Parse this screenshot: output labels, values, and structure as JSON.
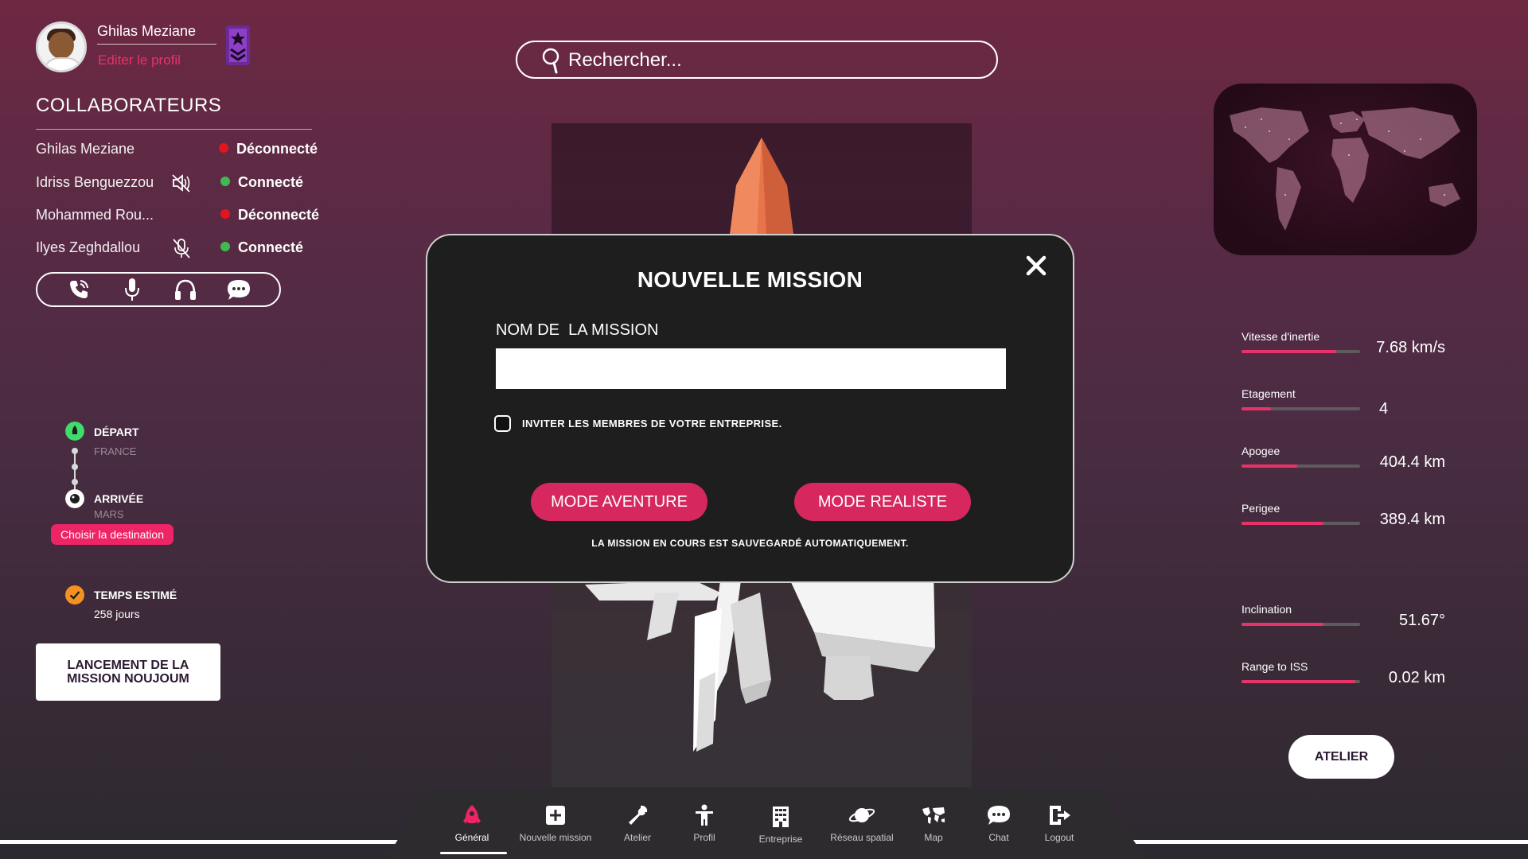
{
  "user": {
    "name": "Ghilas Meziane",
    "edit_label": "Editer le profil"
  },
  "search": {
    "placeholder": "Rechercher..."
  },
  "collaborators": {
    "title": "COLLABORATEURS",
    "items": [
      {
        "name": "Ghilas Meziane",
        "status": "Déconnecté",
        "status_color": "#e4141c",
        "icon": ""
      },
      {
        "name": "Idriss Benguezzou",
        "status": "Connecté",
        "status_color": "#3fb950",
        "icon": "speaker-muted-icon"
      },
      {
        "name": "Mohammed Rou...",
        "status": "Déconnecté",
        "status_color": "#e4141c",
        "icon": ""
      },
      {
        "name": "Ilyes Zeghdallou",
        "status": "Connecté",
        "status_color": "#3fb950",
        "icon": "microphone-muted-icon"
      }
    ],
    "comms_icons": [
      "phone-icon",
      "microphone-icon",
      "headphones-icon",
      "chat-bubble-icon"
    ]
  },
  "route": {
    "departure_label": "DÉPART",
    "departure_place": "FRANCE",
    "arrival_label": "ARRIVÉE",
    "arrival_place": "MARS",
    "choose_destination": "Choisir la destination",
    "estimated_label": "TEMPS ESTIMÉ",
    "estimated_value": "258 jours",
    "launch_label": "LANCEMENT  DE LA\nMISSION NOUJOUM"
  },
  "stats": [
    {
      "label": "Vitesse d'inertie",
      "value": "7.68 km/s",
      "fill": 0.8
    },
    {
      "label": "Etagement",
      "value": "4",
      "fill": 0.25
    },
    {
      "label": "Apogee",
      "value": "404.4 km",
      "fill": 0.47
    },
    {
      "label": "Perigee",
      "value": "389.4 km",
      "fill": 0.69
    },
    {
      "label": "Inclination",
      "value": "51.67°",
      "fill": 0.69
    },
    {
      "label": "Range to ISS",
      "value": "0.02 km",
      "fill": 0.96
    }
  ],
  "atelier_button": "ATELIER",
  "nav": {
    "items": [
      {
        "label": "Général",
        "icon": "rocket-icon",
        "active": true
      },
      {
        "label": "Nouvelle mission",
        "icon": "plus-square-icon",
        "active": false
      },
      {
        "label": "Atelier",
        "icon": "wrench-icon",
        "active": false
      },
      {
        "label": "Profil",
        "icon": "person-icon",
        "active": false
      },
      {
        "label": "Entreprise",
        "icon": "building-icon",
        "active": false
      },
      {
        "label": "Réseau spatial",
        "icon": "planet-icon",
        "active": false
      },
      {
        "label": "Map",
        "icon": "world-map-icon",
        "active": false
      },
      {
        "label": "Chat",
        "icon": "chat-icon",
        "active": false
      },
      {
        "label": "Logout",
        "icon": "logout-icon",
        "active": false
      }
    ]
  },
  "modal": {
    "title": "NOUVELLE MISSION",
    "field_label": "NOM DE  LA MISSION",
    "field_value": "",
    "invite_label": "INVITER LES MEMBRES DE VOTRE ENTREPRISE.",
    "invite_checked": false,
    "mode_adventure": "MODE AVENTURE",
    "mode_realistic": "MODE REALISTE",
    "autosave_note": "LA MISSION EN COURS EST SAUVEGARDÉ AUTOMATIQUEMENT."
  },
  "colors": {
    "accent": "#e8336a",
    "button": "#d6285e",
    "connected": "#3fb950",
    "disconnected": "#e4141c"
  }
}
